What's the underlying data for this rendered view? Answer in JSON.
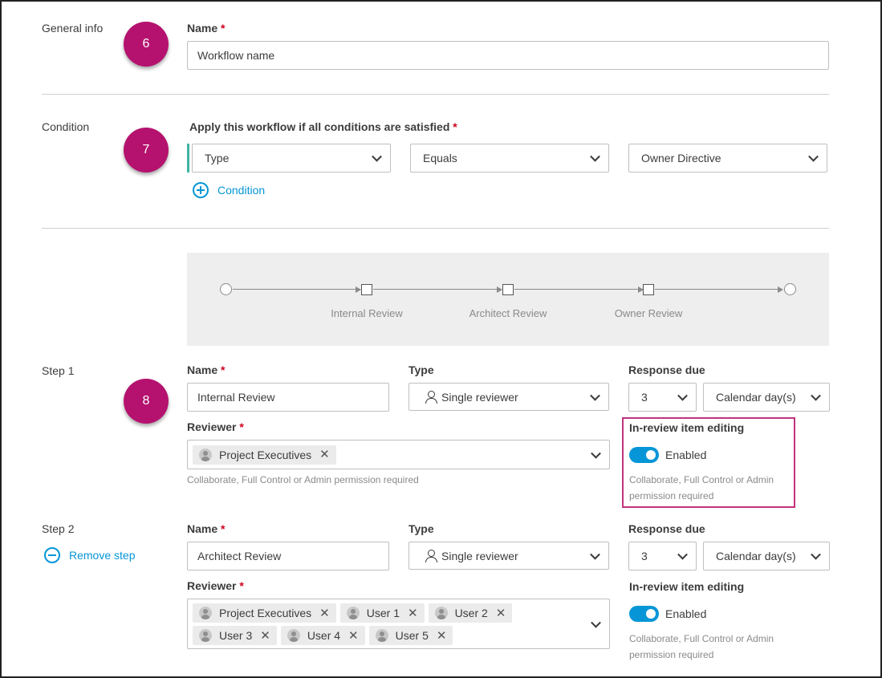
{
  "general": {
    "section_label": "General info",
    "badge": "6",
    "name_label": "Name",
    "required_mark": "*",
    "name_value": "Workflow name"
  },
  "condition": {
    "section_label": "Condition",
    "badge": "7",
    "apply_label": "Apply this workflow if all conditions are satisfied",
    "field_select": "Type",
    "operator_select": "Equals",
    "value_select": "Owner Directive",
    "add_condition_label": "Condition"
  },
  "flow": {
    "steps": [
      "Internal Review",
      "Architect Review",
      "Owner Review"
    ]
  },
  "step1": {
    "section_label": "Step 1",
    "badge": "8",
    "name_label": "Name",
    "name_value": "Internal Review",
    "type_label": "Type",
    "type_value": "Single reviewer",
    "response_label": "Response due",
    "due_number": "3",
    "due_unit": "Calendar day(s)",
    "reviewer_label": "Reviewer",
    "reviewers": [
      "Project Executives"
    ],
    "reviewer_hint": "Collaborate, Full Control or Admin permission required",
    "editing_label": "In-review item editing",
    "editing_state": "Enabled",
    "editing_hint_line1": "Collaborate, Full Control or Admin",
    "editing_hint_line2": "permission required"
  },
  "step2": {
    "section_label": "Step 2",
    "remove_label": "Remove step",
    "name_label": "Name",
    "name_value": "Architect Review",
    "type_label": "Type",
    "type_value": "Single reviewer",
    "response_label": "Response due",
    "due_number": "3",
    "due_unit": "Calendar day(s)",
    "reviewer_label": "Reviewer",
    "reviewers_row1": [
      "Project Executives",
      "User 1",
      "User 2"
    ],
    "reviewers_row2": [
      "User 3",
      "User 4",
      "User 5"
    ],
    "editing_label": "In-review item editing",
    "editing_state": "Enabled",
    "editing_hint_line1": "Collaborate, Full Control or Admin",
    "editing_hint_line2": "permission required"
  },
  "colors": {
    "accent": "#0696d7",
    "badge": "#b5126f",
    "highlight": "#c1337e",
    "required": "#d0021b"
  }
}
